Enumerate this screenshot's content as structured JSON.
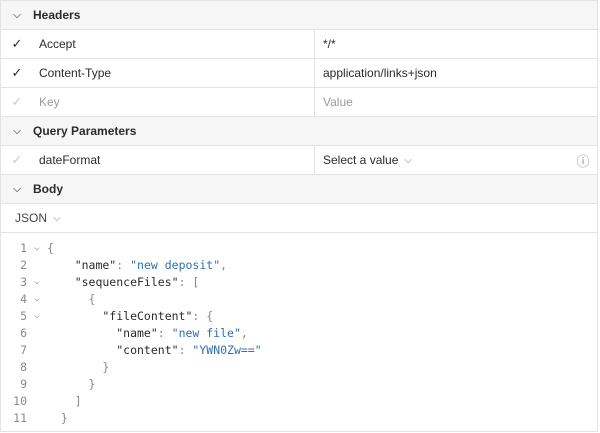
{
  "headers": {
    "title": "Headers",
    "rows": [
      {
        "key": "Accept",
        "value": "*/*"
      },
      {
        "key": "Content-Type",
        "value": "application/links+json"
      }
    ],
    "new_key_placeholder": "Key",
    "new_value_placeholder": "Value"
  },
  "query": {
    "title": "Query Parameters",
    "rows": [
      {
        "key": "dateFormat",
        "value": "Select a value"
      }
    ]
  },
  "body": {
    "title": "Body",
    "format": "JSON",
    "lines": [
      {
        "no": "1",
        "fold": true,
        "parts": [
          {
            "t": "{",
            "c": "p"
          }
        ]
      },
      {
        "no": "2",
        "fold": false,
        "parts": [
          {
            "t": "    \"name\"",
            "c": "k"
          },
          {
            "t": ": ",
            "c": "p"
          },
          {
            "t": "\"new deposit\"",
            "c": "s"
          },
          {
            "t": ",",
            "c": "p"
          }
        ]
      },
      {
        "no": "3",
        "fold": true,
        "parts": [
          {
            "t": "    \"sequenceFiles\"",
            "c": "k"
          },
          {
            "t": ": [",
            "c": "p"
          }
        ]
      },
      {
        "no": "4",
        "fold": true,
        "parts": [
          {
            "t": "      {",
            "c": "p"
          }
        ]
      },
      {
        "no": "5",
        "fold": true,
        "parts": [
          {
            "t": "        \"fileContent\"",
            "c": "k"
          },
          {
            "t": ": {",
            "c": "p"
          }
        ]
      },
      {
        "no": "6",
        "fold": false,
        "parts": [
          {
            "t": "          \"name\"",
            "c": "k"
          },
          {
            "t": ": ",
            "c": "p"
          },
          {
            "t": "\"new file\"",
            "c": "s"
          },
          {
            "t": ",",
            "c": "p"
          }
        ]
      },
      {
        "no": "7",
        "fold": false,
        "parts": [
          {
            "t": "          \"content\"",
            "c": "k"
          },
          {
            "t": ": ",
            "c": "p"
          },
          {
            "t": "\"YWN0Zw==\"",
            "c": "s"
          }
        ]
      },
      {
        "no": "8",
        "fold": false,
        "parts": [
          {
            "t": "        }",
            "c": "p"
          }
        ]
      },
      {
        "no": "9",
        "fold": false,
        "parts": [
          {
            "t": "      }",
            "c": "p"
          }
        ]
      },
      {
        "no": "10",
        "fold": false,
        "parts": [
          {
            "t": "    ]",
            "c": "p"
          }
        ]
      },
      {
        "no": "11",
        "fold": false,
        "parts": [
          {
            "t": "  }",
            "c": "p"
          }
        ]
      }
    ]
  }
}
